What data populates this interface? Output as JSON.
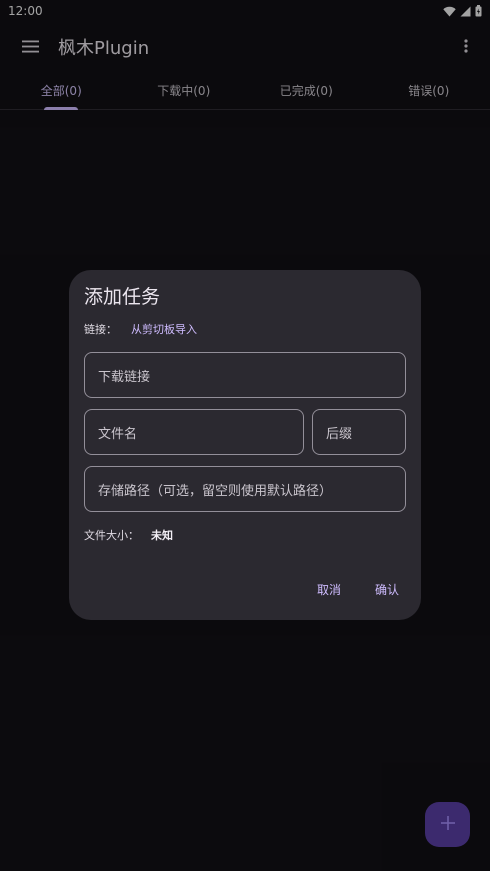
{
  "status_bar": {
    "time": "12:00",
    "icons": [
      "wifi-icon",
      "signal-icon",
      "battery-icon"
    ]
  },
  "app_bar": {
    "title": "枫木Plugin",
    "menu_icon": "hamburger-menu-icon",
    "more_icon": "more-vertical-icon"
  },
  "tabs": [
    {
      "label": "全部(0)",
      "active": true
    },
    {
      "label": "下载中(0)",
      "active": false
    },
    {
      "label": "已完成(0)",
      "active": false
    },
    {
      "label": "错误(0)",
      "active": false
    }
  ],
  "dialog": {
    "title": "添加任务",
    "link_label": "链接：",
    "clipboard_import": "从剪切板导入",
    "url_placeholder": "下载链接",
    "filename_placeholder": "文件名",
    "extension_placeholder": "后缀",
    "path_placeholder": "存储路径（可选，留空则使用默认路径）",
    "size_label": "文件大小：",
    "size_value": "未知",
    "cancel_label": "取消",
    "confirm_label": "确认"
  },
  "fab": {
    "icon": "plus-icon"
  },
  "colors": {
    "background": "#111014",
    "dialog": "#2b2930",
    "accent": "#cfbcff",
    "outline": "#938f99",
    "fab": "#3c2a6e"
  }
}
